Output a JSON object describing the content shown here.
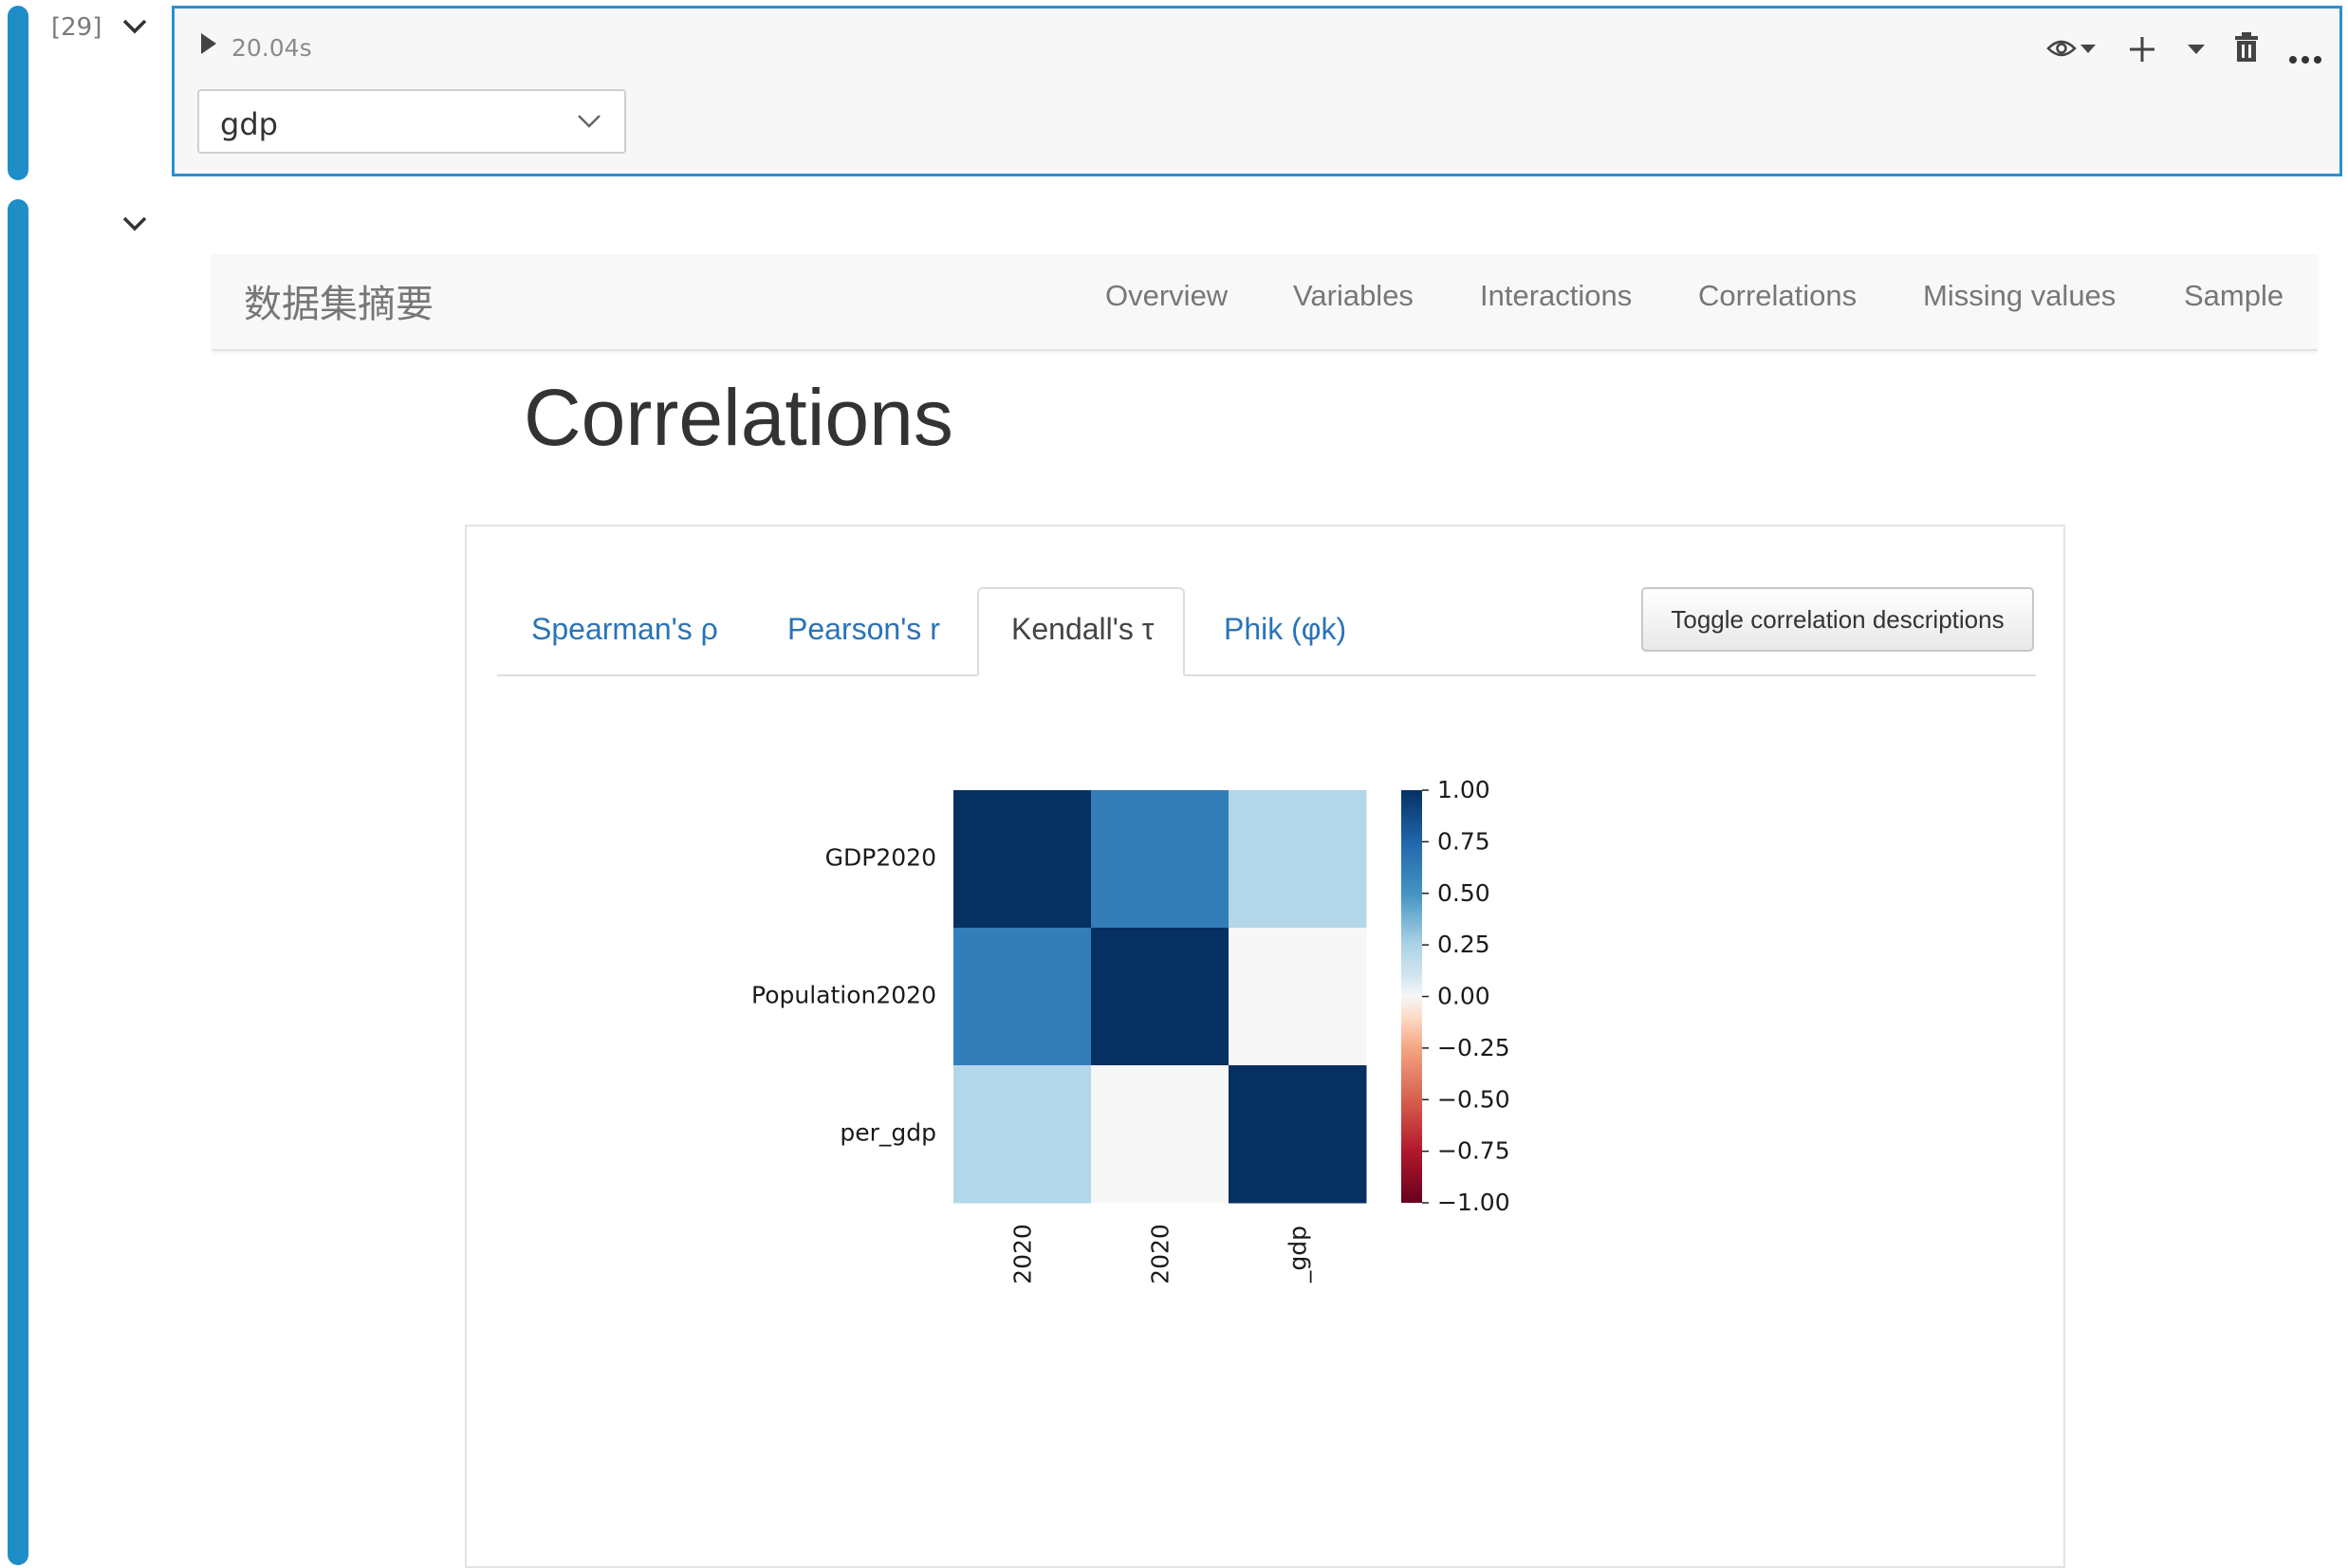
{
  "cell_input": {
    "execution_count": "[29]",
    "exec_time": "20.04s",
    "dropdown_value": "gdp"
  },
  "icons": [
    "play-icon",
    "eye-icon",
    "plus-icon",
    "caret-down-icon",
    "trash-icon",
    "more-icon",
    "chevron-down-icon"
  ],
  "report": {
    "brand": "数据集摘要",
    "nav": [
      "Overview",
      "Variables",
      "Interactions",
      "Correlations",
      "Missing values",
      "Sample"
    ],
    "section_title": "Correlations",
    "tabs": [
      "Spearman's ρ",
      "Pearson's r",
      "Kendall's τ",
      "Phik (φk)"
    ],
    "active_tab": "Kendall's τ",
    "toggle_button": "Toggle correlation descriptions"
  },
  "colors": {
    "accent": "#1f8dc6",
    "link": "#2a73b8",
    "cmap_low": "#67001f",
    "cmap_mid": "#f7f7f7",
    "cmap_high": "#053061"
  },
  "chart_data": {
    "type": "heatmap",
    "rows": [
      "GDP2020",
      "Population2020",
      "per_gdp"
    ],
    "col_labels_visible": [
      "2020",
      "2020",
      "_gdp"
    ],
    "values": [
      [
        1.0,
        0.62,
        0.22
      ],
      [
        0.62,
        1.0,
        0.0
      ],
      [
        0.22,
        0.0,
        1.0
      ]
    ],
    "colorbar_ticks": [
      "1.00",
      "0.75",
      "0.50",
      "0.25",
      "0.00",
      "−0.25",
      "−0.50",
      "−0.75",
      "−1.00"
    ],
    "vmin": -1,
    "vmax": 1,
    "colormap": "RdBu"
  }
}
